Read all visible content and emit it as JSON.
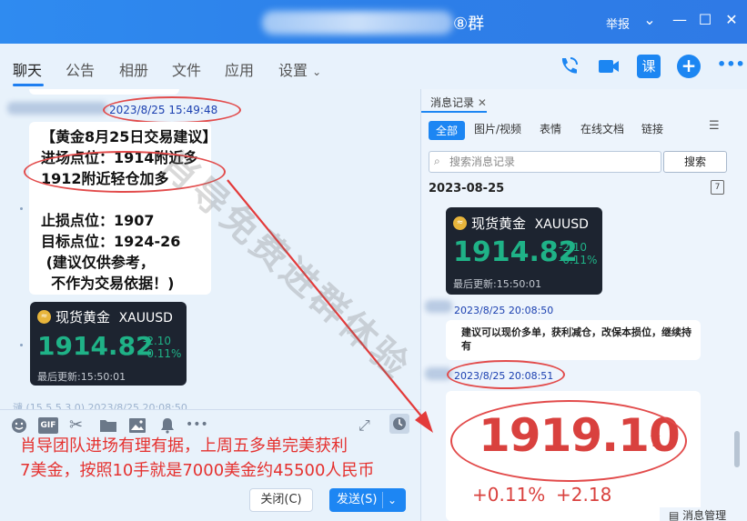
{
  "window": {
    "title_suffix": "⑧群",
    "report": "举报"
  },
  "tabs": [
    "聊天",
    "公告",
    "相册",
    "文件",
    "应用",
    "设置"
  ],
  "toolbar_icons": {
    "call": "phone-icon",
    "video": "video-icon",
    "class": "课",
    "add": "+",
    "more": "•••"
  },
  "chat": {
    "timestamp1": "2023/8/25 15:49:48",
    "advice_lines": [
      "【黄金8月25日交易建议】",
      "进场点位：1914附近多",
      "1912附近轻仓加多",
      "",
      "止损点位：1907",
      "目标点位：1924-26",
      " (建议仅供参考，",
      "  不作为交易依据！)"
    ],
    "card": {
      "name": "现货黄金",
      "symbol": "XAUUSD",
      "price": "1914.82",
      "change": "-2.10",
      "change_pct": "-0.11%",
      "updated": "最后更新:15:50:01"
    },
    "partial_line": "谴 (15 5 5 3 0) 2023/8/25 20:08:50"
  },
  "input": {
    "overlay_line1": "肖导团队进场有理有据，上周五多单完美获利",
    "overlay_line2": "7美金，按照10手就是7000美金约45500人民币",
    "close_label": "关闭(C)",
    "send_label": "发送(S)"
  },
  "history": {
    "tab_label": "消息记录",
    "filters": [
      "全部",
      "图片/视频",
      "表情",
      "在线文档",
      "链接"
    ],
    "search_placeholder": "搜索消息记录",
    "search_button": "搜索",
    "date": "2023-08-25",
    "card": {
      "name": "现货黄金",
      "symbol": "XAUUSD",
      "price": "1914.82",
      "change": "-2.10",
      "change_pct": "-0.11%",
      "updated": "最后更新:15:50:01"
    },
    "ts2": "2023/8/25 20:08:50",
    "msg2": "建议可以现价多单，获利减仓，改保本损位，继续持有",
    "ts3": "2023/8/25 20:08:51",
    "big_price": "1919.10",
    "big_change": "+0.11%",
    "big_change2": "+2.18",
    "manage": "消息管理"
  },
  "watermark": "肖导免费进群体验",
  "colors": {
    "accent": "#1d86f3",
    "gain": "#1fb287",
    "annotation": "#e24b4b",
    "big_price": "#d9413e"
  }
}
